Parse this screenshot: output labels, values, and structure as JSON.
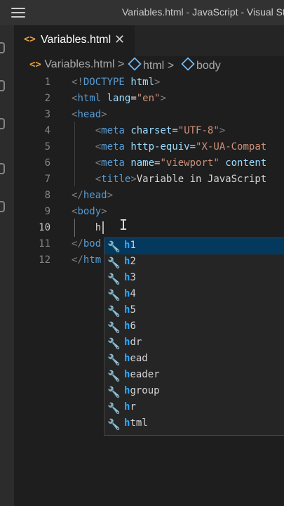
{
  "titlebar": {
    "title": "Variables.html - JavaScript - Visual St"
  },
  "tab": {
    "icon": "<>",
    "label": "Variables.html",
    "close": "✕"
  },
  "breadcrumb": {
    "file_icon": "<>",
    "file": "Variables.html",
    "sep": ">",
    "item1": "html",
    "item2": "body"
  },
  "editor": {
    "line_numbers": [
      "1",
      "2",
      "3",
      "4",
      "5",
      "6",
      "7",
      "8",
      "9",
      "10",
      "11",
      "12"
    ],
    "active_line": "10",
    "typed": "h",
    "lines": {
      "l1": {
        "a": "<!",
        "b": "DOCTYPE",
        "c": "html",
        "d": ">"
      },
      "l2": {
        "a": "<",
        "b": "html",
        "c": "lang",
        "d": "=",
        "e": "\"en\"",
        "f": ">"
      },
      "l3": {
        "a": "<",
        "b": "head",
        "c": ">"
      },
      "l4": {
        "a": "<",
        "b": "meta",
        "c": "charset",
        "d": "=",
        "e": "\"UTF-8\"",
        "f": ">"
      },
      "l5": {
        "a": "<",
        "b": "meta",
        "c": "http-equiv",
        "d": "=",
        "e": "\"X-UA-Compat"
      },
      "l6": {
        "a": "<",
        "b": "meta",
        "c": "name",
        "d": "=",
        "e": "\"viewport\"",
        "f": "content"
      },
      "l7": {
        "a": "<",
        "b": "title",
        "c": ">",
        "d": "Variable in JavaScript"
      },
      "l8": {
        "a": "</",
        "b": "head",
        "c": ">"
      },
      "l9": {
        "a": "<",
        "b": "body",
        "c": ">"
      },
      "l11": {
        "a": "</",
        "b": "bod"
      },
      "l12": {
        "a": "</",
        "b": "htm"
      }
    }
  },
  "suggestions": {
    "match": "h",
    "items": [
      {
        "rest": "1"
      },
      {
        "rest": "2"
      },
      {
        "rest": "3"
      },
      {
        "rest": "4"
      },
      {
        "rest": "5"
      },
      {
        "rest": "6"
      },
      {
        "rest": "dr"
      },
      {
        "rest": "ead"
      },
      {
        "rest": "eader"
      },
      {
        "rest": "group"
      },
      {
        "rest": "r"
      },
      {
        "rest": "tml"
      }
    ],
    "icon": "🔧"
  },
  "colors": {
    "tag": "#569cd6",
    "attr": "#9cdcfe",
    "string": "#ce9178",
    "match_highlight": "#2aaaff",
    "selected_bg": "#04395e"
  }
}
